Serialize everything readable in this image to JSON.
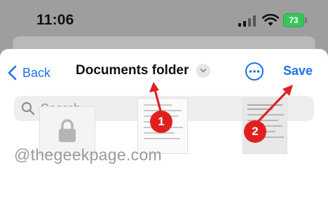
{
  "status_bar": {
    "time": "11:06",
    "battery_level": "73",
    "icons": [
      "cellular-signal-icon",
      "wifi-icon",
      "battery-charging-icon"
    ]
  },
  "nav": {
    "back_label": "Back",
    "title": "Documents folder",
    "save_label": "Save",
    "more_icon": "ellipsis-circle-icon",
    "title_menu_icon": "chevron-down-icon"
  },
  "search": {
    "placeholder": "Search",
    "value": ""
  },
  "thumbnails": [
    {
      "name": "locked-document",
      "icon": "lock-icon"
    },
    {
      "name": "document-thumbnail-1"
    },
    {
      "name": "document-thumbnail-2"
    }
  ],
  "watermark": "@thegeekpage.com",
  "annotations": {
    "step1": "1",
    "step2": "2"
  },
  "colors": {
    "accent": "#1a73e8",
    "battery": "#34c759",
    "annotation": "#e02020",
    "dim_background": "#9e9e9e"
  }
}
